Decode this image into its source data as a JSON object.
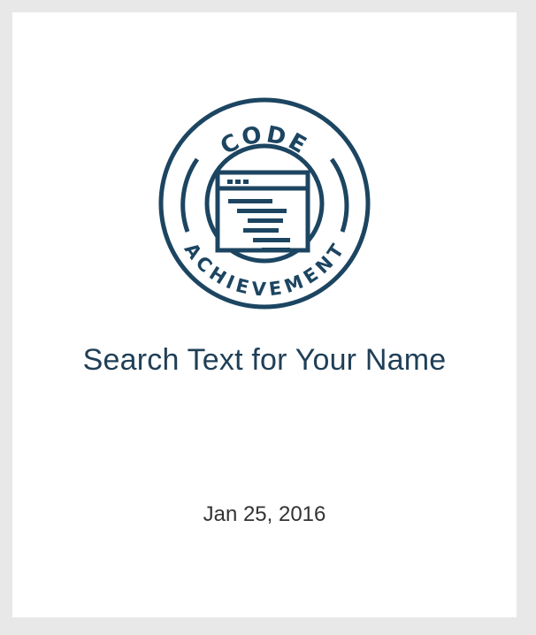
{
  "card": {
    "title": "Search Text for Your Name",
    "date": "Jan 25, 2016"
  },
  "badge": {
    "top_text": "CODE",
    "bottom_text": "ACHIEVEMENT",
    "icon": "code-window-icon",
    "color": "#1c4561"
  }
}
